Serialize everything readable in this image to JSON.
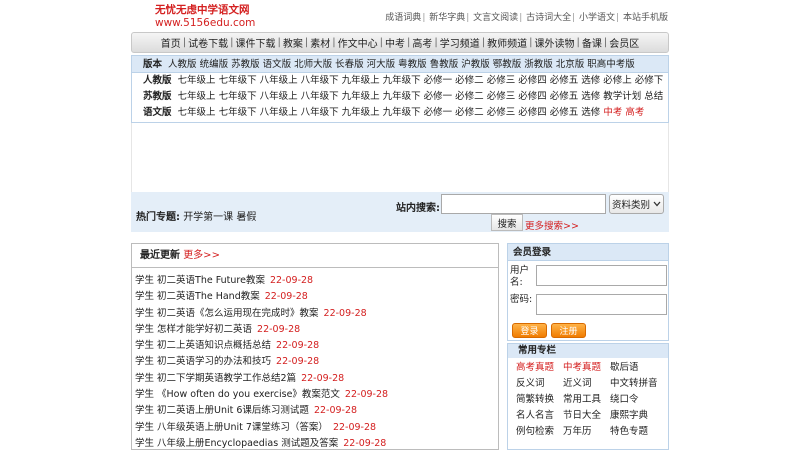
{
  "logo": {
    "title": "无忧无虑中学语文网",
    "domain": "www.5156edu.com"
  },
  "top_links": [
    "成语词典",
    "新华字典",
    "文言文阅读",
    "古诗词大全",
    "小学语文",
    "本站手机版"
  ],
  "nav": [
    "首页",
    "试卷下载",
    "课件下载",
    "教案",
    "素材",
    "作文中心",
    "中考",
    "高考",
    "学习频道",
    "教师频道",
    "课外读物",
    "备课",
    "会员区"
  ],
  "versions": {
    "header_label": "版本",
    "header_items": "人教版 统编版 苏教版 语文版 北师大版 长春版 河大版 粤教版 鲁教版 沪教版 鄂教版 浙教版 北京版 职高中考版",
    "rows": [
      {
        "label": "人教版",
        "items": "七年级上 七年级下 八年级上 八年级下 九年级上 九年级下 必修一 必修二 必修三 必修四 必修五 选修 必修上 必修下",
        "extra": ""
      },
      {
        "label": "苏教版",
        "items": "七年级上 七年级下 八年级上 八年级下 九年级上 九年级下 必修一 必修二 必修三 必修四 必修五 选修 教学计划 总结",
        "extra": ""
      },
      {
        "label": "语文版",
        "items": "七年级上 七年级下 八年级上 八年级下 九年级上 九年级下 必修一 必修二 必修三 必修四 必修五 选修",
        "extra": "中考 高考"
      }
    ]
  },
  "hot": {
    "label": "热门专题:",
    "items": "开学第一课 暑假"
  },
  "search": {
    "label": "站内搜索:",
    "input_value": "",
    "category_label": "资料类别",
    "button_label": "搜索",
    "more_label": "更多搜索>>"
  },
  "recent": {
    "title": "最近更新",
    "more_label": "更多>>",
    "items": [
      {
        "text": "学生 初二英语The Future教案",
        "date": "22-09-28"
      },
      {
        "text": "学生 初二英语The Hand教案",
        "date": "22-09-28"
      },
      {
        "text": "学生 初二英语《怎么运用现在完成时》教案",
        "date": "22-09-28"
      },
      {
        "text": "学生 怎样才能学好初二英语",
        "date": "22-09-28"
      },
      {
        "text": "学生 初二上英语知识点概括总结",
        "date": "22-09-28"
      },
      {
        "text": "学生 初二英语学习的办法和技巧",
        "date": "22-09-28"
      },
      {
        "text": "学生 初二下学期英语教学工作总结2篇",
        "date": "22-09-28"
      },
      {
        "text": "学生 《How often do you exercise》教案范文",
        "date": "22-09-28"
      },
      {
        "text": "学生 初二英语上册Unit 6课后练习测试题",
        "date": "22-09-28"
      },
      {
        "text": "学生 八年级英语上册Unit 7课堂练习（答案）",
        "date": "22-09-28"
      },
      {
        "text": "学生 八年级上册Encyclopaedias 测试题及答案",
        "date": "22-09-28"
      }
    ]
  },
  "member": {
    "title": "会员登录",
    "username_label": "用户名:",
    "password_label": "密码:",
    "username_value": "",
    "password_value": "",
    "login_label": "登录",
    "register_label": "注册"
  },
  "columns": {
    "title": "常用专栏",
    "items": [
      "高考真题",
      "中考真题",
      "歇后语",
      "反义词",
      "近义词",
      "中文转拼音",
      "简繁转换",
      "常用工具",
      "绕口令",
      "名人名言",
      "节日大全",
      "康熙字典",
      "例句检索",
      "万年历",
      "特色专题"
    ],
    "highlight_color": "#d42020"
  }
}
